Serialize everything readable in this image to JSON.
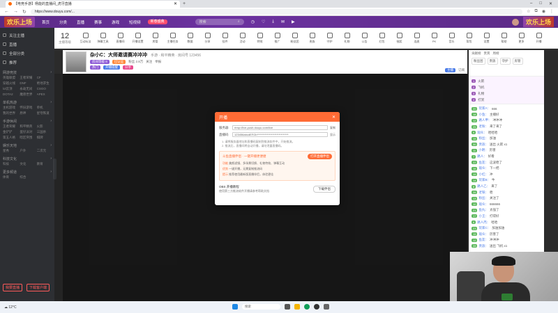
{
  "browser": {
    "tab_title": "【电竞手游】杨能的直播间_虎牙直播",
    "url": "https://www.douyu.com/...",
    "win_minimize": "–",
    "win_maximize": "□",
    "win_close": "✕",
    "new_tab": "+"
  },
  "header": {
    "logo": "欢乐上场",
    "nav": [
      "首页",
      "分类",
      "直播",
      "赛事",
      "游戏",
      "短视频"
    ],
    "event_label": "新春盛典",
    "search_placeholder": "搜索",
    "right_banner": "欢乐上场"
  },
  "sidebar": {
    "items": [
      "关注主播",
      "直播",
      "全部分类",
      "推荐"
    ],
    "sections": [
      {
        "title": "网游竞技",
        "items": [
          "英雄联盟",
          "王者荣耀",
          "CF",
          "穿越火线",
          "DNF",
          "绝地求生",
          "lol云顶",
          "永劫无间",
          "CSGO",
          "DOTA2",
          "魔兽世界",
          "APEX"
        ]
      },
      {
        "title": "单机热游",
        "items": [
          "主机游戏",
          "怀旧游戏",
          "单机",
          "我的世界",
          "原神",
          "星穹铁道"
        ]
      },
      {
        "title": "手游休闲",
        "items": [
          "王者荣耀",
          "和平精英",
          "火影",
          "金铲铲",
          "蛋仔派对",
          "三国杀",
          "第五人格",
          "暗区突围",
          "棋牌"
        ]
      },
      {
        "title": "娱乐天地",
        "items": [
          "星秀",
          "户外",
          "二次元"
        ]
      },
      {
        "title": "科技文化",
        "items": [
          "科技",
          "文化",
          "教育"
        ]
      },
      {
        "title": "更多频道",
        "items": [
          "体育",
          "综合"
        ]
      }
    ],
    "bottom_buttons": [
      "我要直播",
      "下载客户端"
    ]
  },
  "toolbar": {
    "level_num": "12",
    "level_label": "主播等级",
    "tools": [
      "互动玩法",
      "弹幕工具",
      "直播间",
      "开播设置",
      "房管",
      "主播任务",
      "数据",
      "分享",
      "挂件",
      "活动",
      "特效",
      "推广",
      "粉丝团",
      "贵族",
      "守护",
      "礼物",
      "公告",
      "红包",
      "抽奖",
      "连麦",
      "PK",
      "音乐",
      "背包",
      "设置",
      "帮助",
      "更多",
      "开播"
    ]
  },
  "room": {
    "title": "杂小C：大师邀请赛冲冲冲",
    "category": "手游 · 和平精英 · 房间号 123456",
    "tags": [
      "房间等级 8",
      "已认证",
      "热门",
      "开播提醒",
      "分享"
    ],
    "stats": [
      "粉丝 2.8万",
      "关注",
      "举报"
    ],
    "right_info": [
      "主播",
      "订阅"
    ]
  },
  "modal": {
    "title": "开播",
    "close": "✕",
    "server_label": "服务器",
    "server_value": "rtmp://live-push.douyu.com/live",
    "server_check": "复制",
    "key_label": "直播码",
    "key_value": "123456abcdEFGh*****************************",
    "key_check": "显示",
    "note1": "1. 请将服务器地址和直播码复制到推流软件中，开始推流。",
    "note2": "2. 推流后，直播间将自动开播，请勿泄露直播码。",
    "box_title": "斗鱼直播伴侣 · 一键开播更便捷",
    "box_btn": "打开直播伴侣",
    "box_lines": [
      {
        "p": "功能",
        "t": "美颜滤镜、多场景切换、礼物特效、弹幕互动"
      },
      {
        "p": "优势",
        "t": "一键开播，无需复制推流码"
      },
      {
        "p": "提示",
        "t": "推荐使用最新版直播伴侣，体验更佳"
      }
    ],
    "foot_title": "OBS 开播教程",
    "foot_sub": "使用第三方推流软件开播请参考帮助文档",
    "foot_btn": "下载伴侣"
  },
  "right_panel": {
    "top_lines": [
      "贡献榜",
      "贵宾",
      "周榜"
    ],
    "tabs": [
      "粉丝团",
      "贵族",
      "守护",
      "房管"
    ],
    "rank": [
      {
        "badge": "1",
        "text": "火箭"
      },
      {
        "badge": "2",
        "text": "飞机"
      },
      {
        "badge": "3",
        "text": "礼物"
      },
      {
        "badge": "4",
        "text": "打赏"
      }
    ],
    "chat": [
      {
        "lv": "20",
        "name": "玩家A：",
        "msg": "666"
      },
      {
        "lv": "18",
        "name": "小鱼：",
        "msg": "主播好"
      },
      {
        "lv": "12",
        "name": "路人甲：",
        "msg": "冲冲冲"
      },
      {
        "lv": "25",
        "name": "老粉：",
        "msg": "来了来了"
      },
      {
        "lv": "9",
        "name": "观众：",
        "msg": "哈哈哈"
      },
      {
        "lv": "15",
        "name": "粉丝：",
        "msg": "加油"
      },
      {
        "lv": "30",
        "name": "贵族：",
        "msg": "送出 火箭 x1"
      },
      {
        "lv": "11",
        "name": "小明：",
        "msg": "厉害"
      },
      {
        "lv": "7",
        "name": "路人：",
        "msg": "好看"
      },
      {
        "lv": "22",
        "name": "鱼友：",
        "msg": "这波稳了"
      },
      {
        "lv": "16",
        "name": "观众：",
        "msg": "下一把"
      },
      {
        "lv": "19",
        "name": "小红：",
        "msg": "冲"
      },
      {
        "lv": "14",
        "name": "玩家B：",
        "msg": "牛"
      },
      {
        "lv": "8",
        "name": "路人乙：",
        "msg": "来了"
      },
      {
        "lv": "26",
        "name": "老铁：",
        "msg": "稳"
      },
      {
        "lv": "13",
        "name": "粉丝：",
        "msg": "关注了"
      },
      {
        "lv": "10",
        "name": "观众：",
        "msg": "666666"
      },
      {
        "lv": "21",
        "name": "鱼丸：",
        "msg": "太强了"
      },
      {
        "lv": "17",
        "name": "小王：",
        "msg": "打得好"
      },
      {
        "lv": "6",
        "name": "路人丙：",
        "msg": "哈哈"
      },
      {
        "lv": "23",
        "name": "玩家C：",
        "msg": "加油加油"
      },
      {
        "lv": "15",
        "name": "观众：",
        "msg": "厉害了"
      },
      {
        "lv": "12",
        "name": "鱼友：",
        "msg": "冲冲冲"
      },
      {
        "lv": "28",
        "name": "贵族：",
        "msg": "送出 飞机 x1"
      }
    ]
  },
  "taskbar": {
    "weather": "☁ 12°C",
    "search_placeholder": "搜索"
  },
  "colors": {
    "header_purple": "#5b2a86",
    "accent_orange": "#ff6b35",
    "sidebar_bg": "#2d2f33"
  }
}
